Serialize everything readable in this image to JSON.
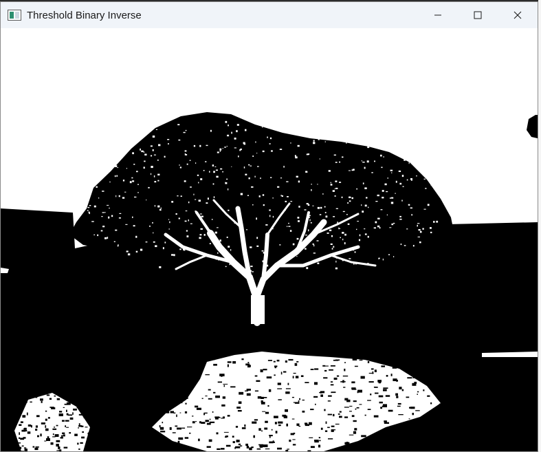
{
  "window": {
    "title": "Threshold Binary Inverse",
    "controls": {
      "minimize_icon": "minimize-icon",
      "maximize_icon": "maximize-icon",
      "close_icon": "close-icon"
    }
  },
  "image": {
    "description_icon": "binary-thresholded-tree-image",
    "foreground_color": "#000000",
    "background_color": "#ffffff"
  }
}
